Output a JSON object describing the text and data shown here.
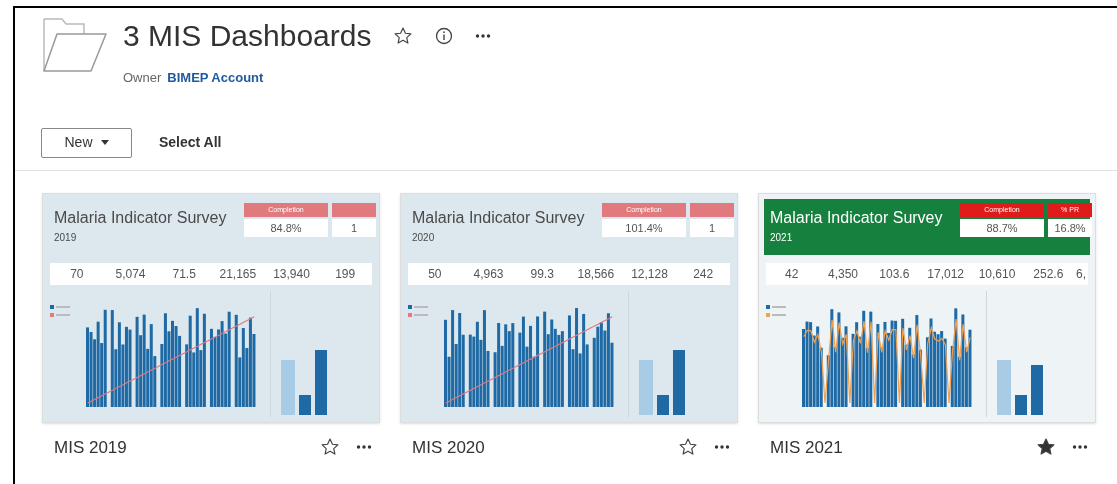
{
  "folder": {
    "title": "3 MIS Dashboards",
    "favorite": false,
    "owner_label": "Owner",
    "owner": "BIMEP Account"
  },
  "toolbar": {
    "new_button": "New",
    "select_all": "Select All"
  },
  "workbooks": [
    {
      "name": "MIS 2019",
      "favorite": false,
      "thumbnail": {
        "kind": "light",
        "title": "Malaria Indicator Survey",
        "year": "2019",
        "kpis": [
          {
            "label": "Completion",
            "value": "84.8%"
          },
          {
            "value": "1"
          }
        ],
        "stats": [
          "70",
          "5,074",
          "71.5",
          "21,165",
          "13,940",
          "199"
        ]
      }
    },
    {
      "name": "MIS 2020",
      "favorite": false,
      "thumbnail": {
        "kind": "light",
        "title": "Malaria Indicator Survey",
        "year": "2020",
        "kpis": [
          {
            "label": "Completion",
            "value": "101.4%"
          },
          {
            "value": "1"
          }
        ],
        "stats": [
          "50",
          "4,963",
          "99.3",
          "18,566",
          "12,128",
          "242"
        ]
      }
    },
    {
      "name": "MIS 2021",
      "favorite": true,
      "thumbnail": {
        "kind": "green",
        "title": "Malaria Indicator Survey",
        "year": "2021",
        "kpis": [
          {
            "label": "Completion",
            "value": "88.7%"
          },
          {
            "label": "% PR",
            "value": "16.8%"
          }
        ],
        "stats": [
          "42",
          "4,350",
          "103.6",
          "17,012",
          "10,610",
          "252.6",
          "6,"
        ]
      }
    }
  ]
}
